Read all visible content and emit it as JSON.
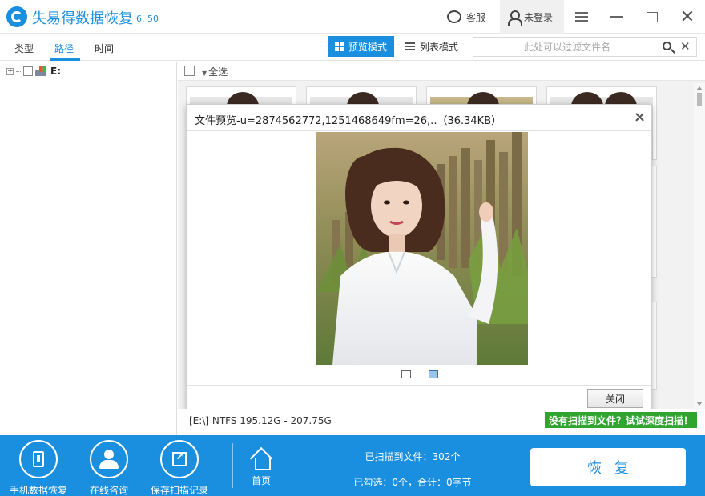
{
  "app": {
    "title": "失易得数据恢复",
    "version": "6. 50",
    "service_label": "客服",
    "login_label": "未登录",
    "accent_color": "#1a8fe0"
  },
  "tabs": [
    {
      "label": "类型",
      "active": false
    },
    {
      "label": "路径",
      "active": true
    },
    {
      "label": "时间",
      "active": false
    }
  ],
  "view_modes": {
    "preview_label": "预览模式",
    "list_label": "列表模式",
    "active": "preview"
  },
  "search": {
    "placeholder": "此处可以过滤文件名",
    "value": ""
  },
  "tree": {
    "drive_label": "E:",
    "expander": "+"
  },
  "select_all_label": "全选",
  "preview_dialog": {
    "title": "文件预览-u=2874562772,1251468649fm=26,..（36.34KB）",
    "close_button_label": "关闭",
    "close_icon": "×"
  },
  "status": {
    "volume_info": "[E:\\] NTFS 195.12G - 207.75G",
    "deep_scan_label": "没有扫描到文件？试试深度扫描！",
    "deep_scan_color": "#2fa52f"
  },
  "bottom_bar": {
    "items": [
      {
        "label": "手机数据恢复",
        "icon": "phone-icon"
      },
      {
        "label": "在线咨询",
        "icon": "person-icon"
      },
      {
        "label": "保存扫描记录",
        "icon": "share-icon"
      }
    ],
    "home_label": "首页",
    "scanned_text": "已扫描到文件：302个",
    "selected_text": "已勾选：0个，合计：0字节",
    "recover_label": "恢复"
  }
}
